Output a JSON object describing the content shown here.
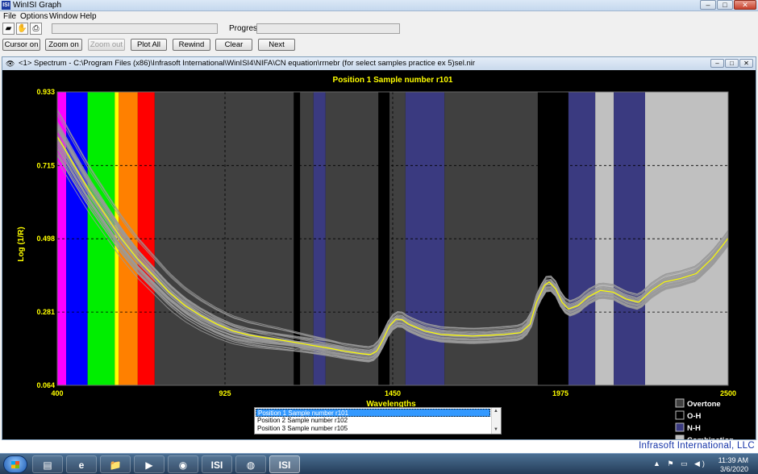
{
  "app": {
    "title": "WinISI Graph",
    "icon_text": "ISI",
    "window_controls": {
      "minimize": "–",
      "maximize": "□",
      "close": "✕"
    }
  },
  "menu": [
    "File",
    "Options",
    "Window",
    "Help"
  ],
  "toolbar1": {
    "icons": [
      "open-folder-icon",
      "hand-icon",
      "printer-icon"
    ],
    "progress_label": "Progress:",
    "status_value": "",
    "progress_value": ""
  },
  "toolbar2": {
    "buttons": [
      {
        "label": "Cursor on",
        "enabled": true
      },
      {
        "label": "Zoom on",
        "enabled": true
      },
      {
        "label": "Zoom out",
        "enabled": false
      },
      {
        "label": "Plot All",
        "enabled": true
      },
      {
        "label": "Rewind",
        "enabled": true
      },
      {
        "label": "Clear",
        "enabled": true
      },
      {
        "label": "Next",
        "enabled": true
      }
    ]
  },
  "spectrum_window": {
    "title": "<1> Spectrum - C:\\Program Files (x86)\\Infrasoft International\\WinISI4\\NIFA\\CN equation\\rrnebr (for select samples practice ex 5)sel.nir"
  },
  "chart_data": {
    "type": "line",
    "title": "Position 1  Sample number r101",
    "xlabel": "Wavelengths",
    "ylabel": "Log (1/R)",
    "xlim": [
      400,
      2500
    ],
    "ylim": [
      0.064,
      0.933
    ],
    "x_ticks": [
      400,
      925,
      1450,
      1975,
      2500
    ],
    "y_ticks": [
      0.064,
      0.281,
      0.498,
      0.715,
      0.933
    ],
    "y_tick_labels": [
      "0.064",
      "0.281",
      "0.498",
      "0.715",
      "0.933"
    ],
    "grid": true,
    "background": "#000000",
    "bands": [
      {
        "from": 400,
        "to": 428,
        "color": "#ff00ff"
      },
      {
        "from": 428,
        "to": 495,
        "color": "#0000ff"
      },
      {
        "from": 495,
        "to": 580,
        "color": "#00ee00"
      },
      {
        "from": 580,
        "to": 592,
        "color": "#ffff00"
      },
      {
        "from": 592,
        "to": 652,
        "color": "#ff8000"
      },
      {
        "from": 652,
        "to": 705,
        "color": "#ff0000"
      },
      {
        "from": 705,
        "to": 1140,
        "color": "#404040"
      },
      {
        "from": 1160,
        "to": 1202,
        "color": "#404040"
      },
      {
        "from": 1202,
        "to": 1240,
        "color": "#3a3a80"
      },
      {
        "from": 1240,
        "to": 1405,
        "color": "#404040"
      },
      {
        "from": 1440,
        "to": 1490,
        "color": "#404040"
      },
      {
        "from": 1490,
        "to": 1612,
        "color": "#3a3a80"
      },
      {
        "from": 1612,
        "to": 1904,
        "color": "#404040"
      },
      {
        "from": 2000,
        "to": 2084,
        "color": "#3a3a80"
      },
      {
        "from": 2084,
        "to": 2142,
        "color": "#c0c0c0"
      },
      {
        "from": 2142,
        "to": 2240,
        "color": "#3a3a80"
      },
      {
        "from": 2240,
        "to": 2500,
        "color": "#c0c0c0"
      }
    ],
    "spectrum_points": [
      [
        400,
        0.8
      ],
      [
        420,
        0.77
      ],
      [
        450,
        0.72
      ],
      [
        500,
        0.64
      ],
      [
        550,
        0.57
      ],
      [
        600,
        0.5
      ],
      [
        650,
        0.44
      ],
      [
        700,
        0.39
      ],
      [
        750,
        0.34
      ],
      [
        800,
        0.3
      ],
      [
        850,
        0.27
      ],
      [
        900,
        0.245
      ],
      [
        950,
        0.225
      ],
      [
        1000,
        0.213
      ],
      [
        1050,
        0.205
      ],
      [
        1100,
        0.198
      ],
      [
        1150,
        0.19
      ],
      [
        1200,
        0.182
      ],
      [
        1250,
        0.174
      ],
      [
        1300,
        0.165
      ],
      [
        1350,
        0.158
      ],
      [
        1380,
        0.155
      ],
      [
        1400,
        0.165
      ],
      [
        1420,
        0.2
      ],
      [
        1440,
        0.24
      ],
      [
        1460,
        0.26
      ],
      [
        1480,
        0.258
      ],
      [
        1500,
        0.245
      ],
      [
        1550,
        0.225
      ],
      [
        1600,
        0.215
      ],
      [
        1650,
        0.212
      ],
      [
        1700,
        0.21
      ],
      [
        1750,
        0.212
      ],
      [
        1800,
        0.215
      ],
      [
        1850,
        0.22
      ],
      [
        1880,
        0.245
      ],
      [
        1900,
        0.31
      ],
      [
        1925,
        0.36
      ],
      [
        1940,
        0.37
      ],
      [
        1960,
        0.35
      ],
      [
        1980,
        0.31
      ],
      [
        2000,
        0.29
      ],
      [
        2030,
        0.3
      ],
      [
        2060,
        0.325
      ],
      [
        2100,
        0.345
      ],
      [
        2140,
        0.34
      ],
      [
        2180,
        0.32
      ],
      [
        2220,
        0.31
      ],
      [
        2260,
        0.345
      ],
      [
        2300,
        0.37
      ],
      [
        2350,
        0.38
      ],
      [
        2400,
        0.395
      ],
      [
        2450,
        0.44
      ],
      [
        2480,
        0.475
      ],
      [
        2500,
        0.5
      ]
    ],
    "highlight_color": "#ffff00",
    "ensemble_color": "#9a9a9a",
    "legend_position": "bottom-right",
    "legend": [
      {
        "label": "Overtone",
        "color": "#404040"
      },
      {
        "label": "O-H",
        "color": "#000000"
      },
      {
        "label": "N-H",
        "color": "#3a3a80"
      },
      {
        "label": "Combination",
        "color": "#c0c0c0"
      }
    ]
  },
  "sample_list": {
    "items": [
      {
        "label": "Position 1  Sample number r101",
        "selected": true
      },
      {
        "label": "Position 2  Sample number r102",
        "selected": false
      },
      {
        "label": "Position 3  Sample number r105",
        "selected": false
      }
    ]
  },
  "footer": {
    "company": "Infrasoft International, LLC"
  },
  "taskbar": {
    "buttons": [
      {
        "name": "explorer-icon",
        "glyph": "▤",
        "active": false
      },
      {
        "name": "internet-explorer-icon",
        "glyph": "e",
        "active": false
      },
      {
        "name": "file-manager-icon",
        "glyph": "📁",
        "active": false
      },
      {
        "name": "media-player-icon",
        "glyph": "▶",
        "active": false
      },
      {
        "name": "chrome-icon",
        "glyph": "◉",
        "active": false
      },
      {
        "name": "isi-app-icon",
        "glyph": "ISI",
        "active": false
      },
      {
        "name": "network-icon",
        "glyph": "◍",
        "active": false
      },
      {
        "name": "isi-graph-icon",
        "glyph": "ISI",
        "active": true
      }
    ],
    "tray_icons": "▲ ⚑ ▭ ◀)",
    "clock_time": "11:39 AM",
    "clock_date": "3/6/2020"
  }
}
